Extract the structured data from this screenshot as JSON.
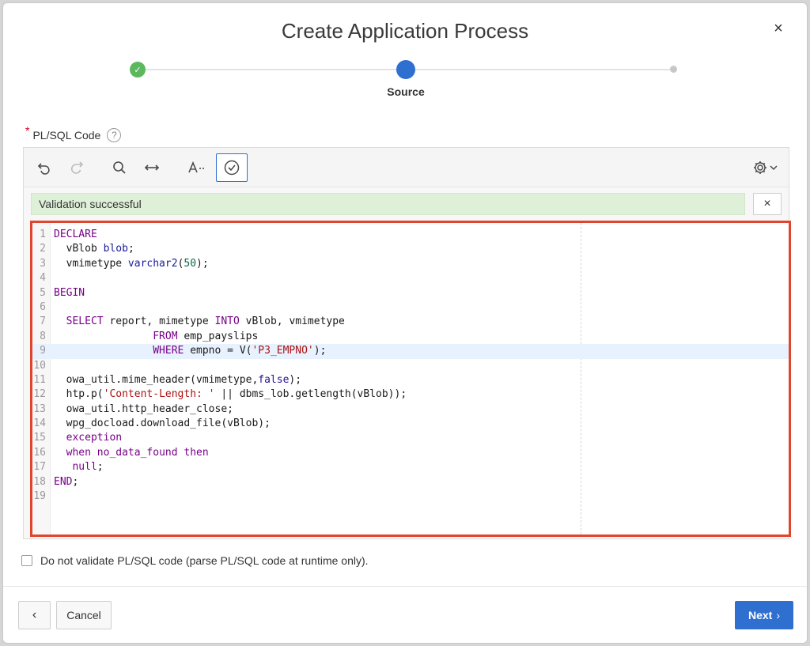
{
  "dialog": {
    "title": "Create Application Process",
    "close_symbol": "×"
  },
  "wizard": {
    "steps": [
      {
        "state": "done",
        "icon": "check-icon"
      },
      {
        "state": "active",
        "label": "Source"
      },
      {
        "state": "pending"
      }
    ],
    "active_label": "Source"
  },
  "field": {
    "label": "PL/SQL Code",
    "required_mark": "*",
    "help_symbol": "?"
  },
  "toolbar": {
    "buttons": [
      "undo-icon",
      "redo-icon",
      "search-icon",
      "arrows-horizontal-icon",
      "text-size-icon",
      "validate-check-icon",
      "settings-gear-icon"
    ]
  },
  "validation": {
    "message": "Validation successful",
    "close_symbol": "×"
  },
  "code": {
    "lines": [
      "DECLARE",
      "  vBlob blob;",
      "  vmimetype varchar2(50);",
      "",
      "BEGIN",
      "",
      "  SELECT report, mimetype INTO vBlob, vmimetype",
      "                FROM emp_payslips",
      "                WHERE empno = V('P3_EMPNO');",
      "",
      "  owa_util.mime_header(vmimetype,false);",
      "  htp.p('Content-Length: ' || dbms_lob.getlength(vBlob));",
      "  owa_util.http_header_close;",
      "  wpg_docload.download_file(vBlob);",
      "  exception",
      "  when no_data_found then",
      "   null;",
      "END;",
      ""
    ],
    "highlighted_line": 9
  },
  "options": {
    "no_validate_label": "Do not validate PL/SQL code (parse PL/SQL code at runtime only).",
    "no_validate_checked": false
  },
  "footer": {
    "back_symbol": "‹",
    "cancel_label": "Cancel",
    "next_label": "Next",
    "next_symbol": "›"
  },
  "colors": {
    "accent": "#2f6fd0",
    "success": "#5cb85c",
    "validation_bg": "#dff0d8",
    "highlight_border": "#e0452e"
  }
}
